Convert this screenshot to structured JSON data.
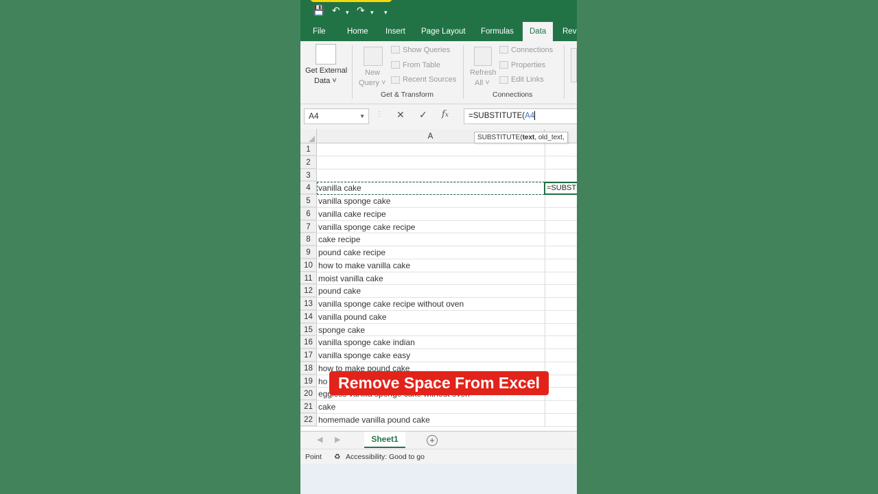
{
  "tabs": [
    "File",
    "Home",
    "Insert",
    "Page Layout",
    "Formulas",
    "Data",
    "Revi"
  ],
  "active_tab": "Data",
  "ribbon": {
    "get_external_data": [
      "Get External",
      "Data"
    ],
    "new_query": [
      "New",
      "Query"
    ],
    "show_queries": "Show Queries",
    "from_table": "From Table",
    "recent_sources": "Recent Sources",
    "group_get_transform": "Get & Transform",
    "refresh_all": [
      "Refresh",
      "All"
    ],
    "connections": "Connections",
    "properties": "Properties",
    "edit_links": "Edit Links",
    "group_connections": "Connections"
  },
  "formula_bar": {
    "name_box": "A4",
    "formula_prefix": "=SUBSTITUTE(",
    "formula_ref": "A4"
  },
  "tooltip": {
    "fn": "SUBSTITUTE(",
    "arg1": "text",
    "rest": ", old_text, "
  },
  "grid": {
    "column_a": "A",
    "edit_cell_text": "=SUBSTITUTE",
    "rows": [
      {
        "n": "1",
        "a": ""
      },
      {
        "n": "2",
        "a": ""
      },
      {
        "n": "3",
        "a": ""
      },
      {
        "n": "4",
        "a": "vanilla cake"
      },
      {
        "n": "5",
        "a": "vanilla sponge cake"
      },
      {
        "n": "6",
        "a": "vanilla cake recipe"
      },
      {
        "n": "7",
        "a": "vanilla sponge cake recipe"
      },
      {
        "n": "8",
        "a": "cake recipe"
      },
      {
        "n": "9",
        "a": "pound cake recipe"
      },
      {
        "n": "10",
        "a": "how to make vanilla cake"
      },
      {
        "n": "11",
        "a": "moist vanilla cake"
      },
      {
        "n": "12",
        "a": "pound cake"
      },
      {
        "n": "13",
        "a": "vanilla sponge cake recipe without oven"
      },
      {
        "n": "14",
        "a": "vanilla pound cake"
      },
      {
        "n": "15",
        "a": "sponge cake"
      },
      {
        "n": "16",
        "a": "vanilla sponge cake indian"
      },
      {
        "n": "17",
        "a": "vanilla sponge cake easy"
      },
      {
        "n": "18",
        "a": "how to make pound cake"
      },
      {
        "n": "19",
        "a": "ho"
      },
      {
        "n": "20",
        "a": "eggless vanilla sponge cake without oven"
      },
      {
        "n": "21",
        "a": "cake"
      },
      {
        "n": "22",
        "a": "homemade vanilla pound cake"
      }
    ]
  },
  "sheet_tab": "Sheet1",
  "status": {
    "mode": "Point",
    "accessibility": "Accessibility: Good to go"
  },
  "caption": "Remove Space From Excel",
  "colors": {
    "excel_green": "#217346",
    "background": "#43835c",
    "caption_red": "#e2231a"
  }
}
